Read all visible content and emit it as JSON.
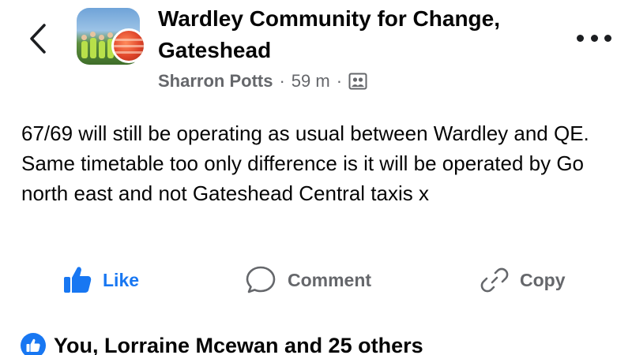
{
  "header": {
    "group_name": "Wardley Community for Change, Gateshead",
    "author": "Sharron Potts",
    "separator": "·",
    "time": "59 m",
    "audience_icon": "group-audience-icon"
  },
  "post": {
    "text": "67/69 will still be operating as usual between Wardley and QE. Same timetable too only difference is it will be operated by Go north east and not Gateshead Central taxis x"
  },
  "actions": {
    "like_label": "Like",
    "comment_label": "Comment",
    "copy_label": "Copy"
  },
  "reactions": {
    "summary": "You, Lorraine Mcewan and 25 others"
  },
  "colors": {
    "accent": "#1877f2",
    "secondary_text": "#65676b",
    "primary_text": "#050505"
  }
}
